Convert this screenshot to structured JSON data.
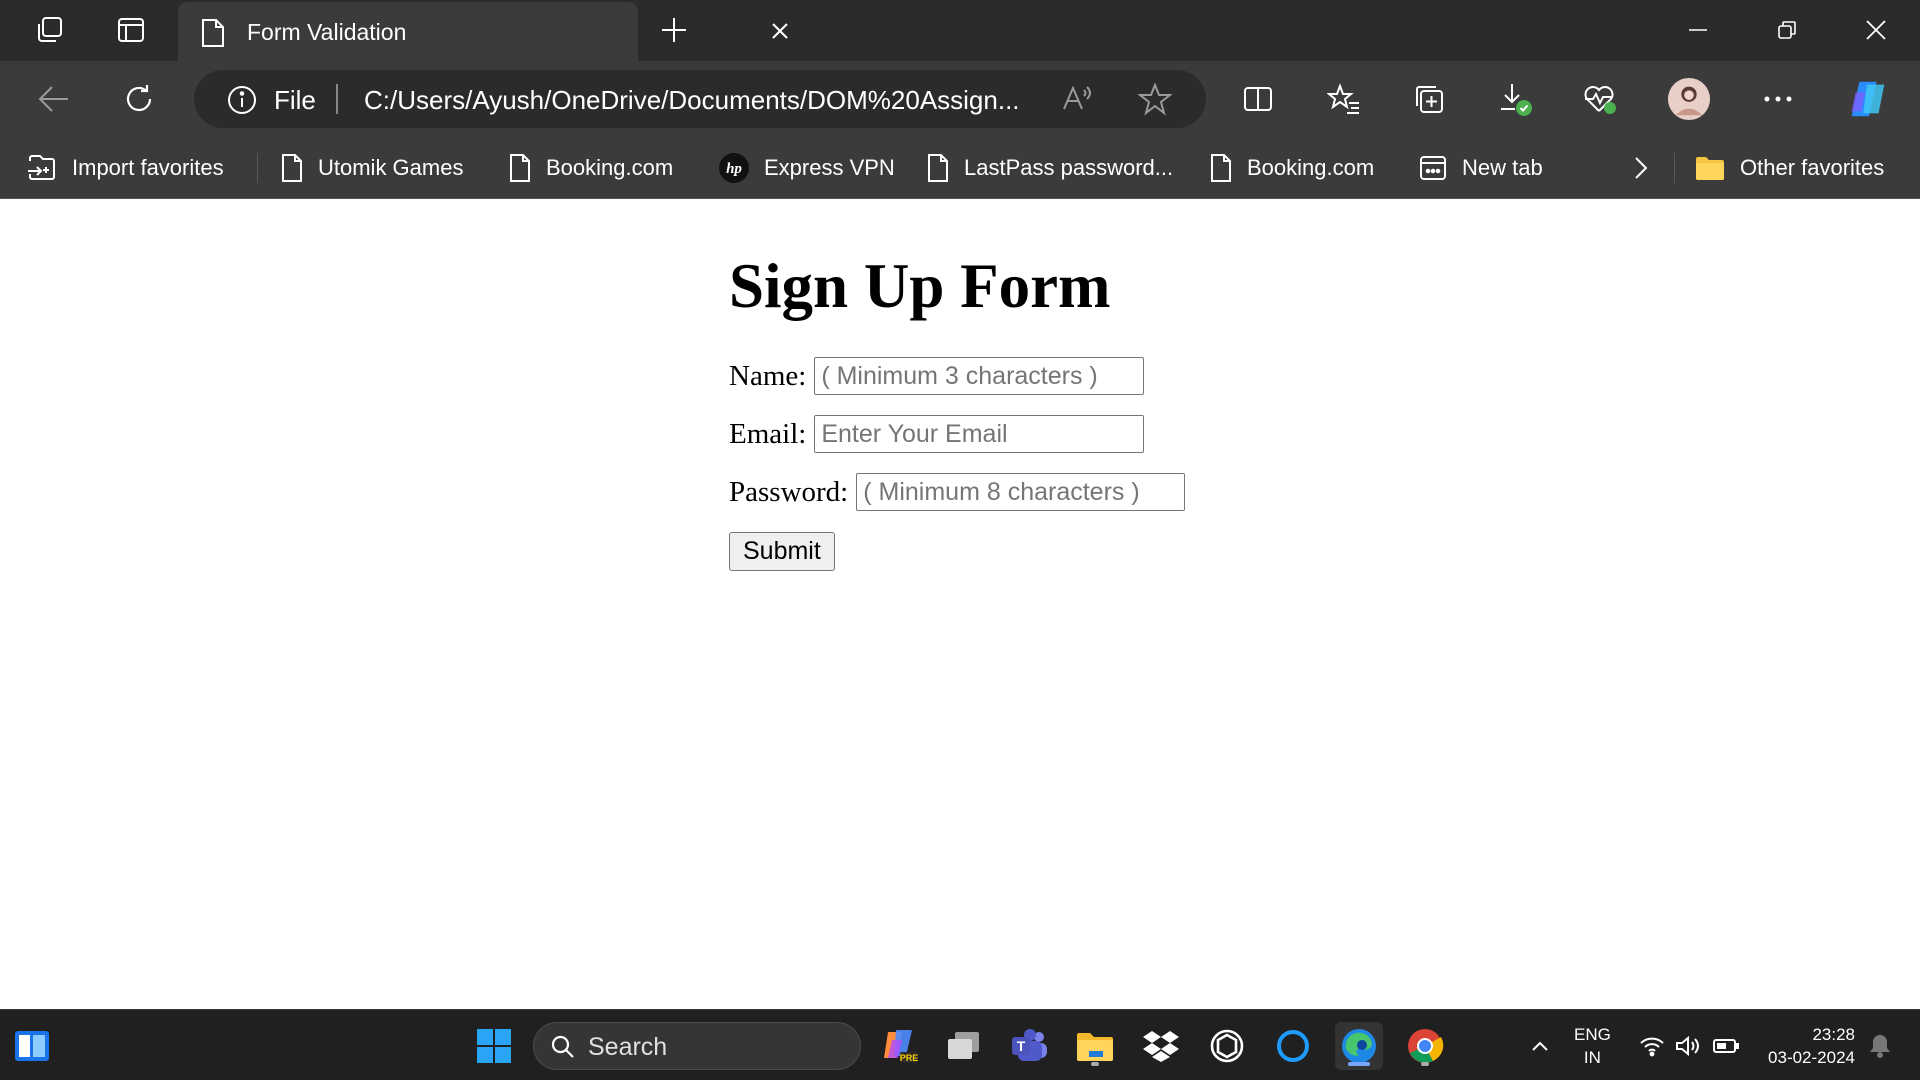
{
  "browser": {
    "tab_title": "Form Validation",
    "address_protocol": "File",
    "address_url": "C:/Users/Ayush/OneDrive/Documents/DOM%20Assign...",
    "favorites": [
      {
        "label": "Import favorites",
        "icon": "import-icon"
      },
      {
        "label": "Utomik Games",
        "icon": "page-icon"
      },
      {
        "label": "Booking.com",
        "icon": "page-icon"
      },
      {
        "label": "Express VPN",
        "icon": "hp-icon"
      },
      {
        "label": "LastPass password...",
        "icon": "page-icon"
      },
      {
        "label": "Booking.com",
        "icon": "page-icon"
      },
      {
        "label": "New tab",
        "icon": "newtab-icon"
      }
    ],
    "other_favorites": "Other favorites"
  },
  "page": {
    "heading": "Sign Up Form",
    "name_label": "Name:",
    "name_placeholder": "( Minimum 3 characters )",
    "email_label": "Email:",
    "email_placeholder": "Enter Your Email",
    "password_label": "Password:",
    "password_placeholder": "( Minimum 8 characters )",
    "submit_label": "Submit"
  },
  "taskbar": {
    "search_placeholder": "Search",
    "lang_line1": "ENG",
    "lang_line2": "IN",
    "time": "23:28",
    "date": "03-02-2024"
  },
  "colors": {
    "tabbar": "#2b2b2b",
    "toolbar": "#3b3b3b",
    "taskbar": "#202020",
    "edge_blue": "#1e88e5"
  }
}
